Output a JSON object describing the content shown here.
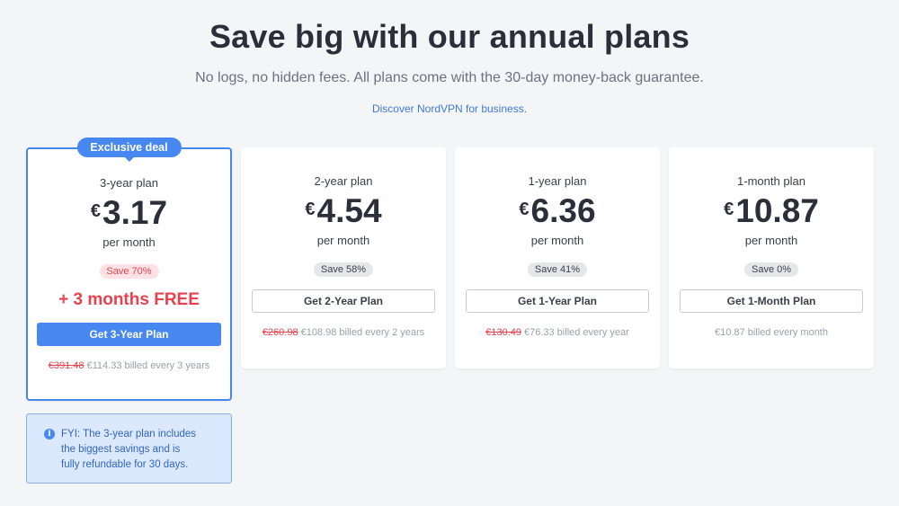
{
  "header": {
    "title": "Save big with our annual plans",
    "subtitle": "No logs, no hidden fees. All plans come with the 30-day money-back guarantee.",
    "business_link": "Discover NordVPN for business."
  },
  "plans": [
    {
      "badge": "Exclusive deal",
      "name": "3-year plan",
      "currency": "€",
      "price": "3.17",
      "period": "per month",
      "save": "Save 70%",
      "bonus": "+ 3 months FREE",
      "cta": "Get 3-Year Plan",
      "old_price": "€391.48",
      "billing": "€114.33 billed every 3 years"
    },
    {
      "name": "2-year plan",
      "currency": "€",
      "price": "4.54",
      "period": "per month",
      "save": "Save 58%",
      "cta": "Get 2-Year Plan",
      "old_price": "€260.98",
      "billing": "€108.98 billed every 2 years"
    },
    {
      "name": "1-year plan",
      "currency": "€",
      "price": "6.36",
      "period": "per month",
      "save": "Save 41%",
      "cta": "Get 1-Year Plan",
      "old_price": "€130.49",
      "billing": "€76.33 billed every year"
    },
    {
      "name": "1-month plan",
      "currency": "€",
      "price": "10.87",
      "period": "per month",
      "save": "Save 0%",
      "cta": "Get 1-Month Plan",
      "billing": "€10.87 billed every month"
    }
  ],
  "fyi": {
    "icon": "info-icon",
    "icon_glyph": "i",
    "lines": [
      "FYI: The 3-year plan includes",
      "the biggest savings and is",
      "fully refundable for 30 days."
    ]
  },
  "colors": {
    "accent": "#4687f0",
    "sale": "#e8424f",
    "background": "#f4f5f7"
  }
}
